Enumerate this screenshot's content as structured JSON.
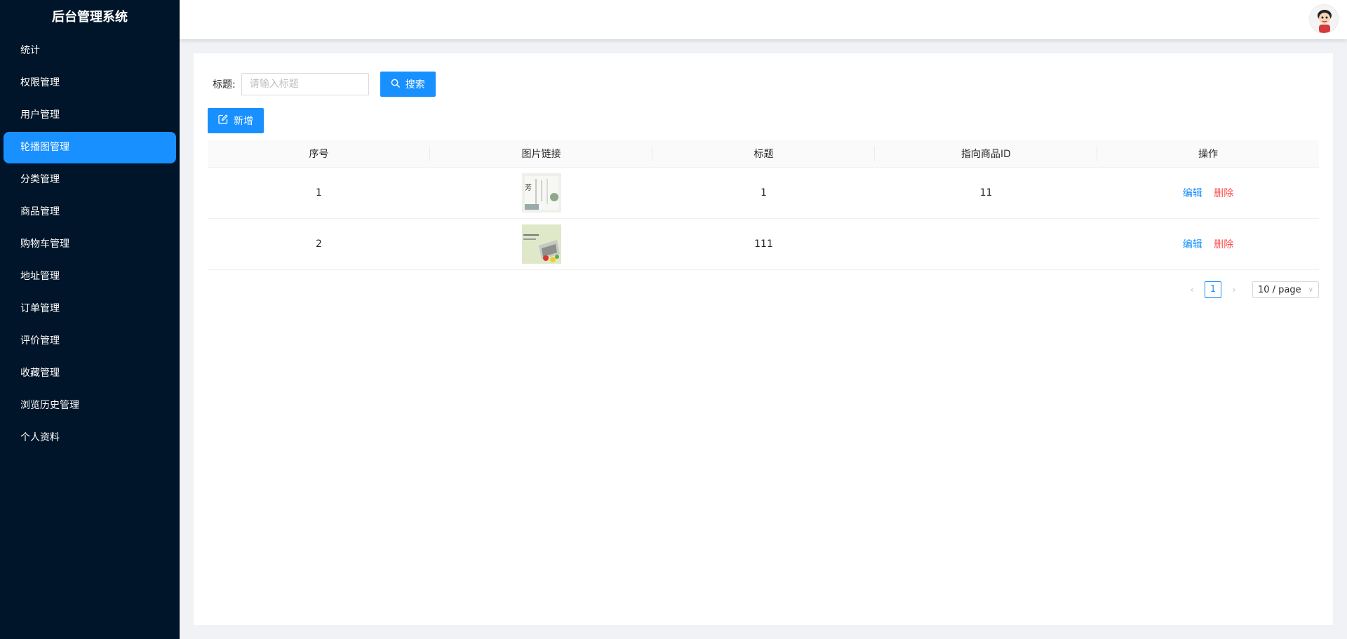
{
  "sidebar": {
    "brand": "后台管理系统",
    "items": [
      {
        "label": "统计",
        "active": false
      },
      {
        "label": "权限管理",
        "active": false
      },
      {
        "label": "用户管理",
        "active": false
      },
      {
        "label": "轮播图管理",
        "active": true
      },
      {
        "label": "分类管理",
        "active": false
      },
      {
        "label": "商品管理",
        "active": false
      },
      {
        "label": "购物车管理",
        "active": false
      },
      {
        "label": "地址管理",
        "active": false
      },
      {
        "label": "订单管理",
        "active": false
      },
      {
        "label": "评价管理",
        "active": false
      },
      {
        "label": "收藏管理",
        "active": false
      },
      {
        "label": "浏览历史管理",
        "active": false
      },
      {
        "label": "个人资料",
        "active": false
      }
    ]
  },
  "header": {
    "avatar_icon": "user-avatar"
  },
  "search": {
    "label": "标题:",
    "placeholder": "请输入标题",
    "value": "",
    "button_label": "搜索",
    "button_icon": "search-icon"
  },
  "toolbar": {
    "add_label": "新增",
    "add_icon": "edit-icon"
  },
  "table": {
    "columns": [
      "序号",
      "图片链接",
      "标题",
      "指向商品ID",
      "操作"
    ],
    "rows": [
      {
        "index": "1",
        "image": "thumbnail",
        "title": "1",
        "product_id": "11",
        "edit": "编辑",
        "delete": "删除"
      },
      {
        "index": "2",
        "image": "thumbnail",
        "title": "111",
        "product_id": "",
        "edit": "编辑",
        "delete": "删除"
      }
    ]
  },
  "pagination": {
    "current_page": "1",
    "page_size": "10 / page"
  },
  "colors": {
    "sidebar_bg": "#001529",
    "primary": "#1890ff",
    "danger": "#ff4d4f"
  }
}
